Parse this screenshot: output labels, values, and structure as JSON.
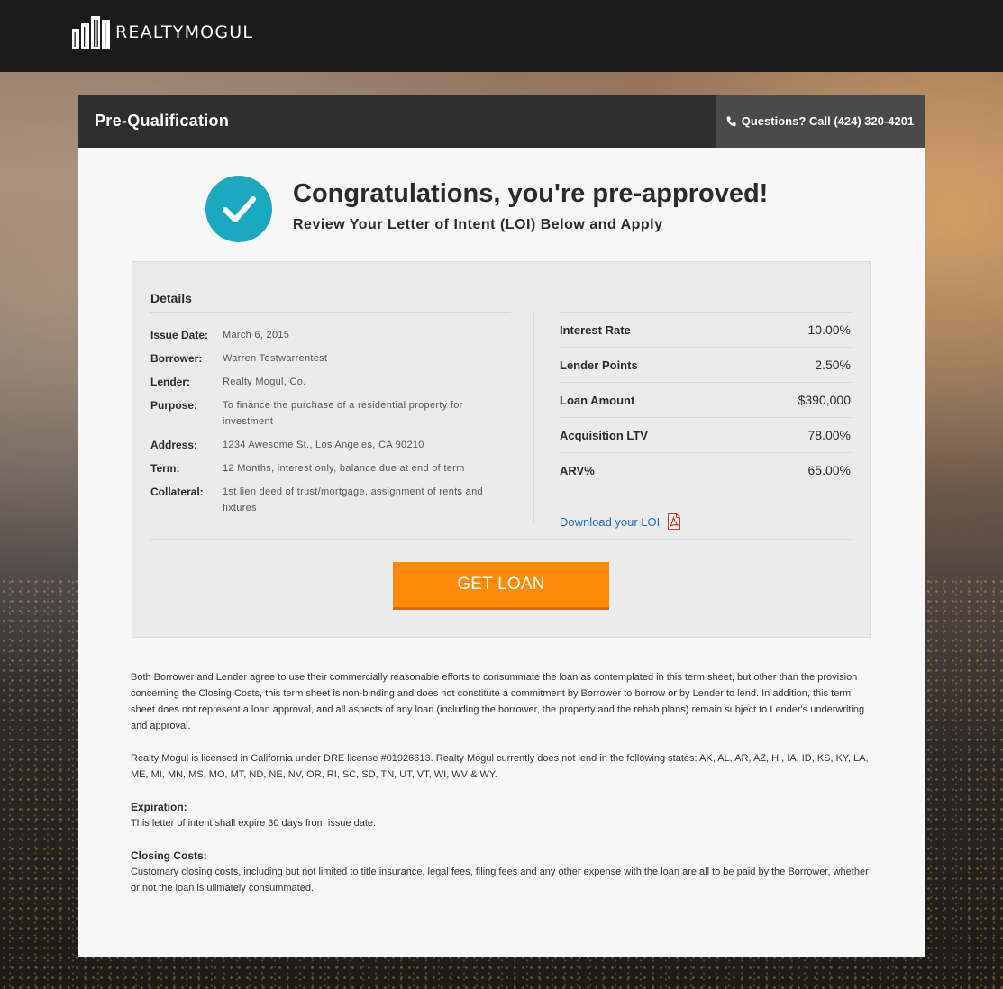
{
  "brand": {
    "name": "REALTYMOGUL"
  },
  "header": {
    "title": "Pre-Qualification",
    "phone_label": "Questions? Call (424) 320-4201"
  },
  "hero": {
    "title": "Congratulations, you're pre-approved!",
    "subtitle": "Review Your Letter of Intent (LOI) Below and Apply"
  },
  "details": {
    "heading": "Details",
    "rows": [
      {
        "label": "Issue Date:",
        "value": "March 6, 2015"
      },
      {
        "label": "Borrower:",
        "value": "Warren Testwarrentest"
      },
      {
        "label": "Lender:",
        "value": "Realty Mogul, Co."
      },
      {
        "label": "Purpose:",
        "value": "To finance the purchase of a residential property for investment"
      },
      {
        "label": "Address:",
        "value": "1234 Awesome St., Los Angeles, CA 90210"
      },
      {
        "label": "Term:",
        "value": "12 Months, interest only, balance due at end of term"
      },
      {
        "label": "Collateral:",
        "value": "1st lien deed of trust/mortgage, assignment of rents and fixtures"
      }
    ]
  },
  "terms": [
    {
      "label": "Interest Rate",
      "value": "10.00%"
    },
    {
      "label": "Lender Points",
      "value": "2.50%"
    },
    {
      "label": "Loan Amount",
      "value": "$390,000"
    },
    {
      "label": "Acquisition LTV",
      "value": "78.00%"
    },
    {
      "label": "ARV%",
      "value": "65.00%"
    }
  ],
  "download_label": "Download your LOI",
  "cta_label": "GET LOAN",
  "legal": {
    "p1": "Both Borrower and Lender agree to use their commercially reasonable efforts to consummate the loan as contemplated in this term sheet, but other than the provision concerning the Closing Costs, this term sheet is non-binding and does not constitute a commitment by Borrower to borrow or by Lender to lend. In addition, this term sheet does not represent a loan approval, and all aspects of any loan (including the borrower, the property and the rehab plans) remain subject to Lender's underwriting and approval.",
    "p2": "Realty Mogul is licensed in California under DRE license #01926613. Realty Mogul currently does not lend in the following states: AK, AL, AR, AZ, HI, IA, ID, KS, KY, LA, ME, MI, MN, MS, MO, MT, ND, NE, NV, OR, RI, SC, SD, TN, UT, VT, WI, WV & WY.",
    "expiration_heading": "Expiration:",
    "expiration_text": "This letter of intent shall expire 30 days from issue date.",
    "closing_heading": "Closing Costs:",
    "closing_text": "Customary closing costs, including but not limited to title insurance, legal fees, filing fees and any other expense with the loan are all to be paid by the Borrower, whether or not the loan is ulimately consummated."
  },
  "colors": {
    "accent": "#1aa9bf",
    "cta": "#ff8a0a",
    "link": "#1f6fb8",
    "topbar": "#1b1b1b"
  },
  "icons": [
    "building-logo-icon",
    "phone-icon",
    "checkmark-icon",
    "pdf-icon"
  ]
}
